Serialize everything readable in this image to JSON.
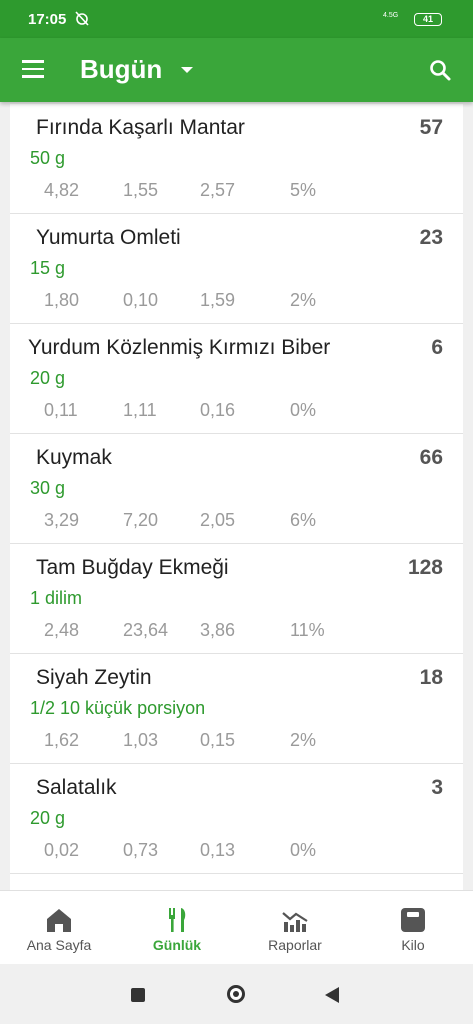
{
  "status_bar": {
    "time": "17:05",
    "signal": "4.5G",
    "battery": "41"
  },
  "app_bar": {
    "title": "Bugün"
  },
  "foods": [
    {
      "name": "Fırında Kaşarlı Mantar",
      "calories": "57",
      "portion": "50 g",
      "macros": [
        "4,82",
        "1,55",
        "2,57",
        "5%"
      ]
    },
    {
      "name": "Yumurta Omleti",
      "calories": "23",
      "portion": "15 g",
      "macros": [
        "1,80",
        "0,10",
        "1,59",
        "2%"
      ]
    },
    {
      "name": "Yurdum Közlenmiş Kırmızı Biber",
      "calories": "6",
      "portion": "20 g",
      "macros": [
        "0,11",
        "1,11",
        "0,16",
        "0%"
      ]
    },
    {
      "name": "Kuymak",
      "calories": "66",
      "portion": "30 g",
      "macros": [
        "3,29",
        "7,20",
        "2,05",
        "6%"
      ]
    },
    {
      "name": "Tam Buğday Ekmeği",
      "calories": "128",
      "portion": "1 dilim",
      "macros": [
        "2,48",
        "23,64",
        "3,86",
        "11%"
      ]
    },
    {
      "name": "Siyah Zeytin",
      "calories": "18",
      "portion": "1/2 10 küçük porsiyon",
      "macros": [
        "1,62",
        "1,03",
        "0,15",
        "2%"
      ]
    },
    {
      "name": "Salatalık",
      "calories": "3",
      "portion": "20 g",
      "macros": [
        "0,02",
        "0,73",
        "0,13",
        "0%"
      ]
    }
  ],
  "bottom_nav": [
    {
      "label": "Ana Sayfa",
      "icon": "home-icon"
    },
    {
      "label": "Günlük",
      "icon": "fork-knife-icon"
    },
    {
      "label": "Raporlar",
      "icon": "chart-icon"
    },
    {
      "label": "Kilo",
      "icon": "scale-icon"
    }
  ],
  "colors": {
    "primary": "#3aa63a",
    "status_bar": "#2e9a2e",
    "portion_text": "#2e9a2e"
  }
}
